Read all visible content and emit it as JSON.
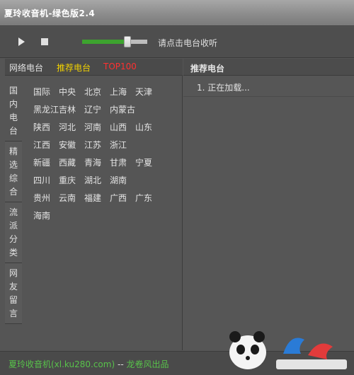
{
  "window": {
    "title": "夏玲收音机-绿色版2.4"
  },
  "player": {
    "volume": 0.7,
    "status": "请点击电台收听"
  },
  "categories": {
    "tabs": [
      "网络电台",
      "推荐电台",
      "TOP100"
    ],
    "side_tabs": [
      "国内电台",
      "精选综合",
      "流派分类",
      "网友留言"
    ],
    "regions": [
      [
        "国际",
        "中央",
        "北京",
        "上海",
        "天津"
      ],
      [
        "黑龙江",
        "吉林",
        "辽宁",
        "内蒙古"
      ],
      [
        "陕西",
        "河北",
        "河南",
        "山西",
        "山东"
      ],
      [
        "江西",
        "安徽",
        "江苏",
        "浙江"
      ],
      [
        "新疆",
        "西藏",
        "青海",
        "甘肃",
        "宁夏"
      ],
      [
        "四川",
        "重庆",
        "湖北",
        "湖南"
      ],
      [
        "贵州",
        "云南",
        "福建",
        "广西",
        "广东"
      ],
      [
        "海南"
      ]
    ]
  },
  "recommend": {
    "header": "推荐电台",
    "items": [
      "1. 正在加载..."
    ]
  },
  "footer": {
    "site": "夏玲收音机(xl.ku280.com)",
    "sep": "--",
    "author": "龙卷风出品"
  },
  "colors": {
    "volume_fill": "#3da32f",
    "tab_active": "#f2d200",
    "tab_top": "#ff3030",
    "footer_text": "#58c24a"
  }
}
